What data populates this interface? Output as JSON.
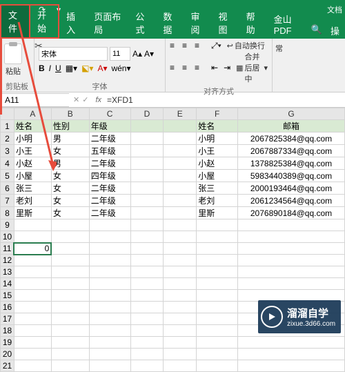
{
  "title_bar": {
    "right_text": "文档"
  },
  "menu": {
    "file": "文件",
    "home": "开始",
    "insert": "插入",
    "layout": "页面布局",
    "formula": "公式",
    "data": "数据",
    "review": "审阅",
    "view": "视图",
    "help": "帮助",
    "pdf": "金山PDF",
    "ops": "操"
  },
  "ribbon": {
    "paste": "粘贴",
    "clipboard_label": "剪贴板",
    "font_name": "宋体",
    "font_size": "11",
    "font_label": "字体",
    "wrap_text": "自动换行",
    "merge": "合并后居中",
    "align_label": "对齐方式",
    "last_label": "常"
  },
  "formula_bar": {
    "name_box": "A11",
    "fx": "fx",
    "value": "=XFD1"
  },
  "columns": [
    "A",
    "B",
    "C",
    "D",
    "E",
    "F",
    "G"
  ],
  "rows": [
    {
      "n": "1",
      "A": "姓名",
      "B": "性别",
      "C": "年级",
      "F": "姓名",
      "G": "邮箱"
    },
    {
      "n": "2",
      "A": "小明",
      "B": "男",
      "C": "二年级",
      "F": "小明",
      "G": "2067825384@qq.com"
    },
    {
      "n": "3",
      "A": "小王",
      "B": "女",
      "C": "五年级",
      "F": "小王",
      "G": "2067887334@qq.com"
    },
    {
      "n": "4",
      "A": "小赵",
      "B": "男",
      "C": "二年级",
      "F": "小赵",
      "G": "1378825384@qq.com"
    },
    {
      "n": "5",
      "A": "小屋",
      "B": "女",
      "C": "四年级",
      "F": "小屋",
      "G": "5983440389@qq.com"
    },
    {
      "n": "6",
      "A": "张三",
      "B": "女",
      "C": "二年级",
      "F": "张三",
      "G": "2000193464@qq.com"
    },
    {
      "n": "7",
      "A": "老刘",
      "B": "女",
      "C": "二年级",
      "F": "老刘",
      "G": "2061234564@qq.com"
    },
    {
      "n": "8",
      "A": "里斯",
      "B": "女",
      "C": "二年级",
      "F": "里斯",
      "G": "2076890184@qq.com"
    },
    {
      "n": "9"
    },
    {
      "n": "10"
    },
    {
      "n": "11",
      "A": "0"
    },
    {
      "n": "12"
    },
    {
      "n": "13"
    },
    {
      "n": "14"
    },
    {
      "n": "15"
    },
    {
      "n": "16"
    },
    {
      "n": "17"
    },
    {
      "n": "18"
    },
    {
      "n": "19"
    },
    {
      "n": "20"
    },
    {
      "n": "21"
    }
  ],
  "watermark": {
    "main": "溜溜自学",
    "sub": "zixue.3d66.com"
  }
}
